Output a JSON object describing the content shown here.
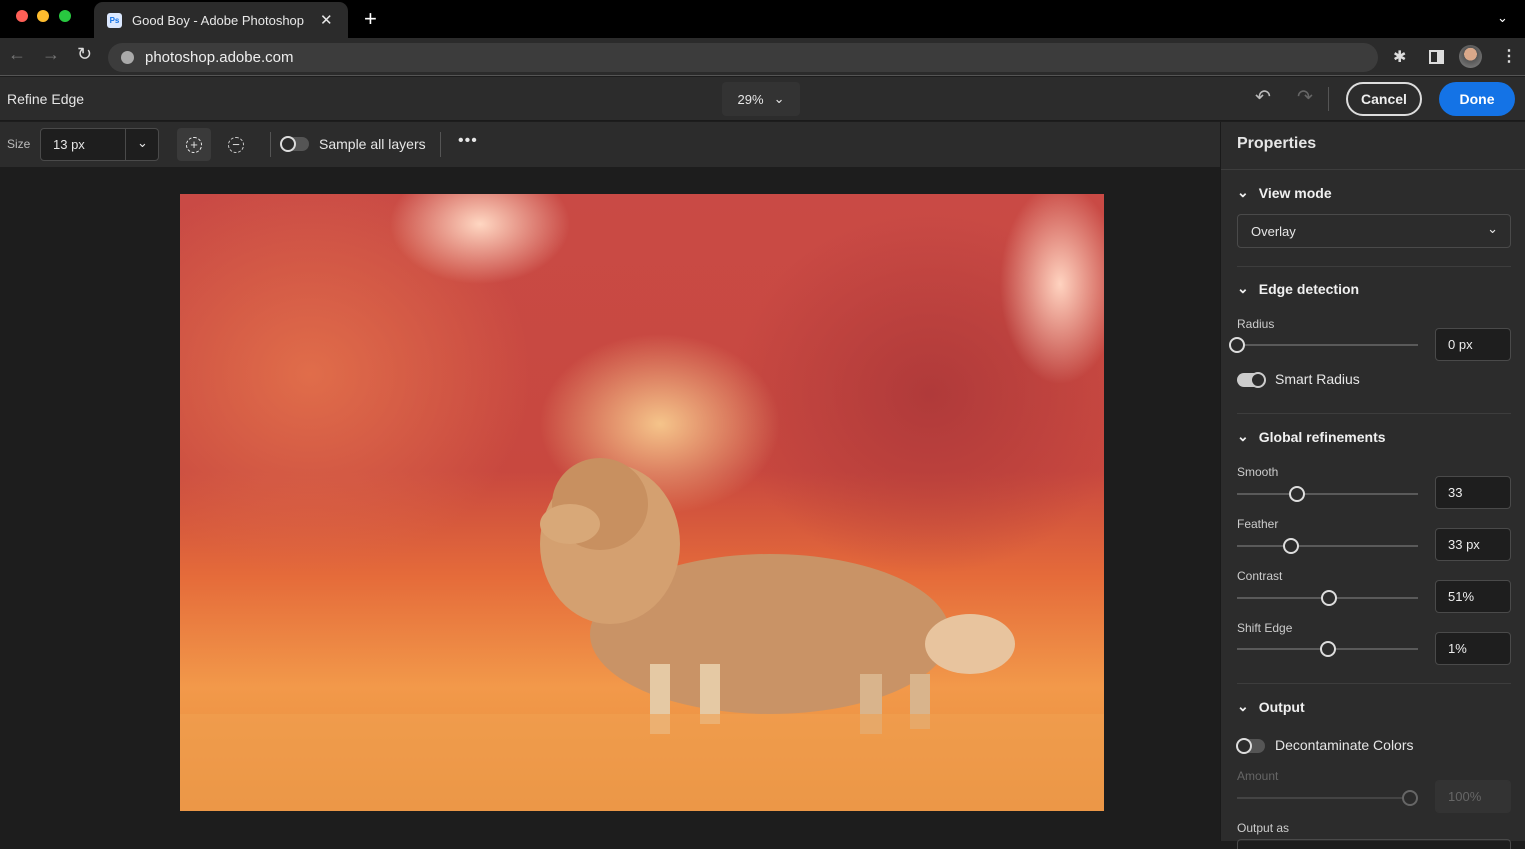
{
  "browser": {
    "tab_title": "Good Boy - Adobe Photoshop",
    "tab_icon": "Ps",
    "url": "photoshop.adobe.com"
  },
  "header": {
    "title": "Refine Edge",
    "zoom": "29%",
    "cancel": "Cancel",
    "done": "Done"
  },
  "toolbar": {
    "size_label": "Size",
    "size_value": "13 px",
    "sample_all_layers": "Sample all layers",
    "sample_all_layers_on": false
  },
  "panel": {
    "title": "Properties",
    "view_mode": {
      "heading": "View mode",
      "value": "Overlay"
    },
    "edge_detection": {
      "heading": "Edge detection",
      "radius_label": "Radius",
      "radius_value": "0 px",
      "radius_fraction": 0,
      "smart_radius": "Smart Radius",
      "smart_radius_on": true
    },
    "global": {
      "heading": "Global refinements",
      "smooth_label": "Smooth",
      "smooth_value": "33",
      "smooth_fraction": 0.33,
      "feather_label": "Feather",
      "feather_value": "33 px",
      "feather_fraction": 0.3,
      "contrast_label": "Contrast",
      "contrast_value": "51%",
      "contrast_fraction": 0.51,
      "shift_label": "Shift Edge",
      "shift_value": "1%",
      "shift_fraction": 0.505
    },
    "output": {
      "heading": "Output",
      "decontaminate": "Decontaminate Colors",
      "decontaminate_on": false,
      "amount_label": "Amount",
      "amount_value": "100%",
      "amount_fraction": 1,
      "output_as_label": "Output as"
    }
  },
  "colors": {
    "accent": "#1473e6"
  }
}
